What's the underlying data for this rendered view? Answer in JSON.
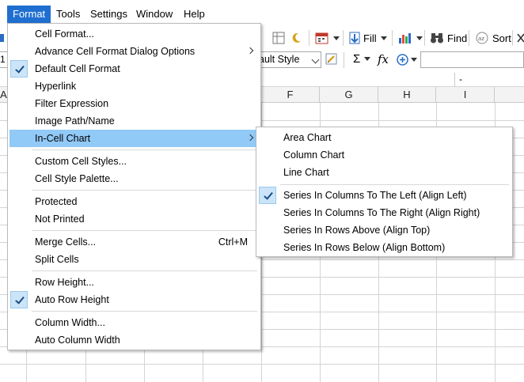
{
  "menubar": {
    "items": [
      {
        "label": "Format",
        "active": true
      },
      {
        "label": "Tools"
      },
      {
        "label": "Settings"
      },
      {
        "label": "Window"
      },
      {
        "label": "Help"
      }
    ]
  },
  "toolbar": {
    "fill_label": "Fill",
    "find_label": "Find",
    "sort_label": "Sort"
  },
  "formula_bar": {
    "name_box_value": "1",
    "cell_style_value": "ault Style",
    "sum_symbol": "Σ",
    "fx_symbol": "fx",
    "formula_value": ""
  },
  "sheet": {
    "dash_label": "-",
    "column_headers": [
      "F",
      "G",
      "H",
      "I"
    ],
    "left_partial_header": "A"
  },
  "format_menu": {
    "items": [
      {
        "label": "Cell Format...",
        "checked": false,
        "submenu": false
      },
      {
        "label": "Advance Cell Format Dialog Options",
        "checked": false,
        "submenu": true
      },
      {
        "label": "Default Cell Format",
        "checked": true,
        "submenu": false
      },
      {
        "label": "Hyperlink",
        "checked": false,
        "submenu": false
      },
      {
        "label": "Filter Expression",
        "checked": false,
        "submenu": false
      },
      {
        "label": "Image Path/Name",
        "checked": false,
        "submenu": false
      },
      {
        "label": "In-Cell Chart",
        "checked": false,
        "submenu": true,
        "highlighted": true
      },
      {
        "label": "Custom Cell Styles...",
        "checked": false,
        "submenu": false
      },
      {
        "label": "Cell Style Palette...",
        "checked": false,
        "submenu": false
      },
      {
        "label": "Protected",
        "checked": false,
        "submenu": false
      },
      {
        "label": "Not Printed",
        "checked": false,
        "submenu": false
      },
      {
        "label": "Merge Cells...",
        "checked": false,
        "submenu": false,
        "shortcut": "Ctrl+M"
      },
      {
        "label": "Split Cells",
        "checked": false,
        "submenu": false
      },
      {
        "label": "Row Height...",
        "checked": false,
        "submenu": false
      },
      {
        "label": "Auto Row Height",
        "checked": true,
        "submenu": false
      },
      {
        "label": "Column Width...",
        "checked": false,
        "submenu": false
      },
      {
        "label": "Auto Column Width",
        "checked": false,
        "submenu": false
      }
    ]
  },
  "incell_chart_submenu": {
    "items": [
      {
        "label": "Area Chart",
        "checked": false
      },
      {
        "label": "Column Chart",
        "checked": false
      },
      {
        "label": "Line Chart",
        "checked": false
      },
      {
        "label": "Series In Columns To The Left (Align Left)",
        "checked": true
      },
      {
        "label": "Series In Columns To The Right (Align Right)",
        "checked": false
      },
      {
        "label": "Series In Rows Above (Align Top)",
        "checked": false
      },
      {
        "label": "Series In Rows Below (Align Bottom)",
        "checked": false
      }
    ]
  },
  "colors": {
    "menubar_active": "#1f6fd1",
    "menu_highlight": "#91c9f7",
    "check_box": "#cce4f7"
  }
}
